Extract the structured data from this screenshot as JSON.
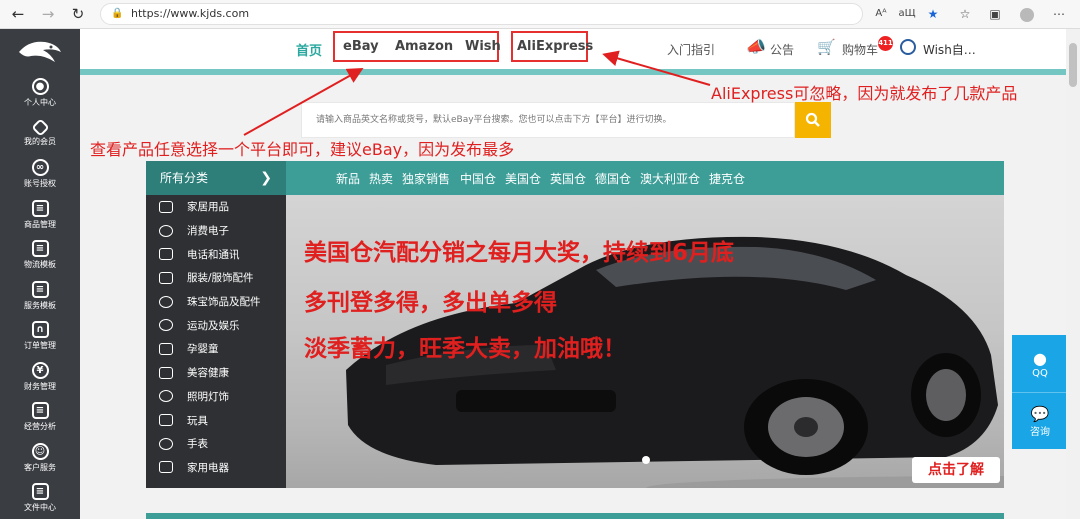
{
  "browser": {
    "url": "https://www.kjds.com",
    "icons": [
      "back-icon",
      "forward-icon",
      "refresh-icon",
      "lock-icon",
      "read-aloud-icon",
      "translate-icon",
      "favorite-star-icon",
      "favorites-icon",
      "collections-icon",
      "profile-icon",
      "more-icon"
    ],
    "read_aloud_label": "Aᴬ",
    "translate_label": "aЩ"
  },
  "sidebar": {
    "items": [
      {
        "label": "个人中心",
        "icon": "user-icon"
      },
      {
        "label": "我的会员",
        "icon": "diamond-icon"
      },
      {
        "label": "账号授权",
        "icon": "link-icon"
      },
      {
        "label": "商品管理",
        "icon": "document-icon"
      },
      {
        "label": "物流模板",
        "icon": "document-icon"
      },
      {
        "label": "服务模板",
        "icon": "document-icon"
      },
      {
        "label": "订单管理",
        "icon": "bag-icon"
      },
      {
        "label": "财务管理",
        "icon": "money-icon"
      },
      {
        "label": "经营分析",
        "icon": "chart-doc-icon"
      },
      {
        "label": "客户服务",
        "icon": "people-icon"
      },
      {
        "label": "文件中心",
        "icon": "file-icon"
      }
    ]
  },
  "nav": {
    "home": "首页",
    "platforms": [
      "eBay",
      "Amazon",
      "Wish"
    ],
    "aliexpress": "AliExpress",
    "guide": "入门指引",
    "notice": "公告",
    "cart": "购物车",
    "cart_count": "411",
    "user": "Wish自…"
  },
  "search": {
    "placeholder": "请输入商品英文名称或货号，默认eBay平台搜索。您也可以点击下方【平台】进行切换。"
  },
  "annotations": {
    "aliexpress_note": "AliExpress可忽略，因为就发布了几款产品",
    "platform_note": "查看产品任意选择一个平台即可，建议eBay，因为发布最多"
  },
  "categories": {
    "all_label": "所有分类",
    "tabs": [
      "新品",
      "热卖",
      "独家销售",
      "中国仓",
      "美国仓",
      "英国仓",
      "德国仓",
      "澳大利亚仓",
      "捷克仓"
    ],
    "list": [
      {
        "label": "家居用品",
        "icon": "sofa-icon"
      },
      {
        "label": "消费电子",
        "icon": "speaker-icon"
      },
      {
        "label": "电话和通讯",
        "icon": "tablet-icon"
      },
      {
        "label": "服装/服饰配件",
        "icon": "shirt-icon"
      },
      {
        "label": "珠宝饰品及配件",
        "icon": "ring-icon"
      },
      {
        "label": "运动及娱乐",
        "icon": "ball-icon"
      },
      {
        "label": "孕婴童",
        "icon": "baby-icon"
      },
      {
        "label": "美容健康",
        "icon": "beauty-icon"
      },
      {
        "label": "照明灯饰",
        "icon": "bulb-icon"
      },
      {
        "label": "玩具",
        "icon": "toy-icon"
      },
      {
        "label": "手表",
        "icon": "watch-icon"
      },
      {
        "label": "家用电器",
        "icon": "appliance-icon"
      }
    ]
  },
  "banner": {
    "line1": "美国仓汽配分销之每月大奖，持续到6月底",
    "line2": "多刊登多得，多出单多得",
    "line3": "淡季蓄力，旺季大卖，加油哦！",
    "detail_button": "点击了解"
  },
  "float": {
    "qq": "QQ",
    "consult": "咨询"
  },
  "colors": {
    "teal": "#3d9e98",
    "sidebar": "#3a3d42",
    "annotation_red": "#e02020",
    "search_button": "#f5b400",
    "float_blue": "#1aa6e6"
  }
}
